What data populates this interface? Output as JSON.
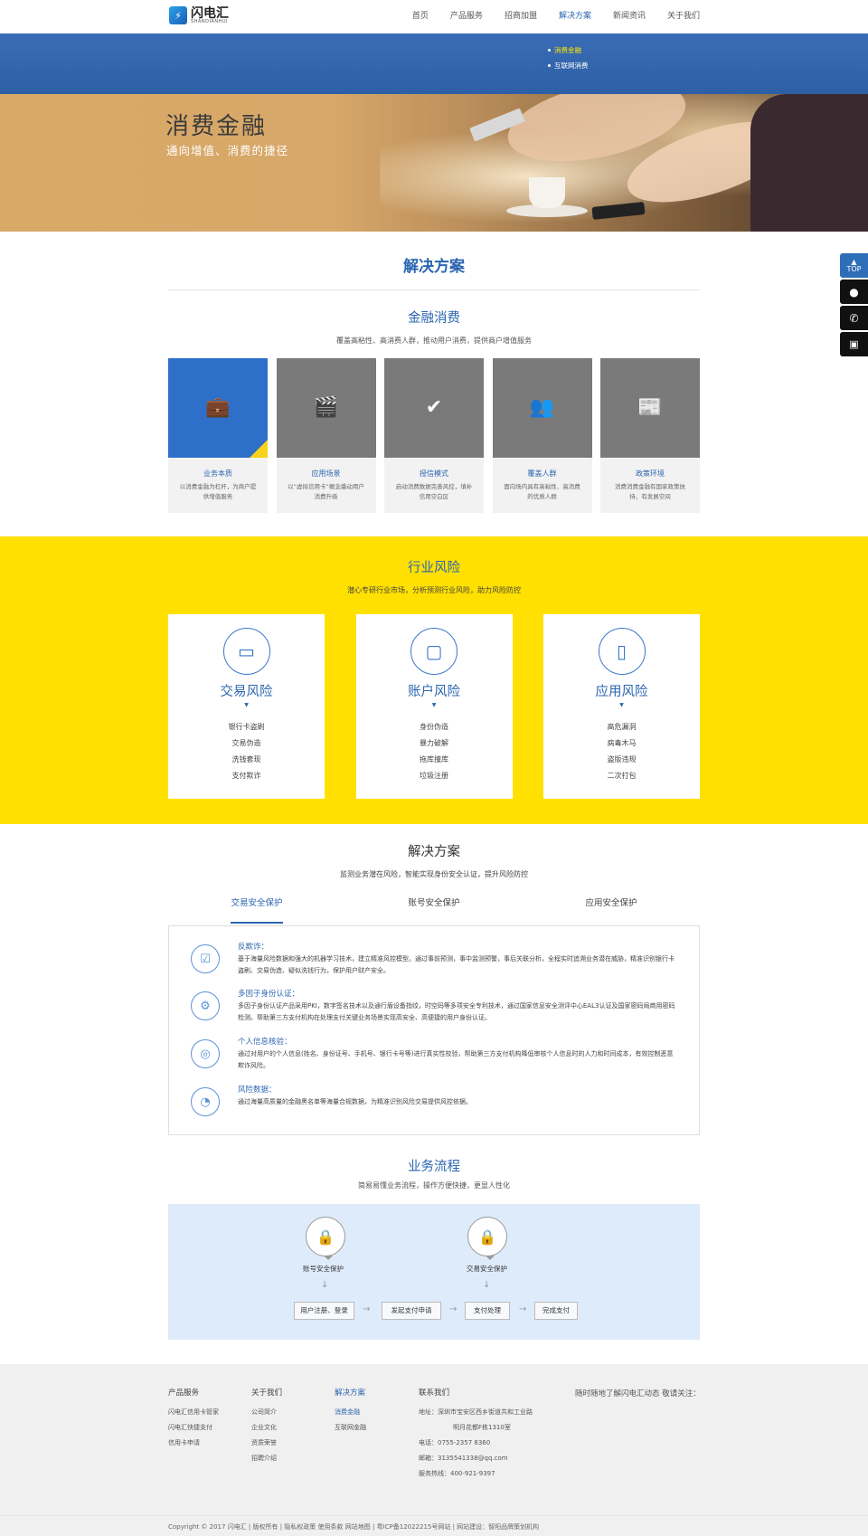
{
  "header": {
    "logo_cn": "闪电汇",
    "logo_en": "SHANDIANHUI",
    "nav": [
      "首页",
      "产品服务",
      "招商加盟",
      "解决方案",
      "新闻资讯",
      "关于我们"
    ]
  },
  "subnav": [
    "消费金融",
    "互联网消费"
  ],
  "banner": {
    "title": "消费金融",
    "subtitle": "通向增值、消费的捷径"
  },
  "side": {
    "top": "TOP"
  },
  "solutions_title": "解决方案",
  "finance": {
    "title": "金融消费",
    "desc": "覆盖高粘性、高消费人群，推动用户消费，提供商户增值服务",
    "cards": [
      {
        "title": "业务本质",
        "desc": "以消费金融为杠杆，为商户提供增值服务"
      },
      {
        "title": "应用场景",
        "desc": "以“虚拟信用卡”概念撬动用户消费升级"
      },
      {
        "title": "授信模式",
        "desc": "启动消费数据完善风控，填补信用空白区"
      },
      {
        "title": "覆盖人群",
        "desc": "面向场内具有高粘性、高消费的优质人群"
      },
      {
        "title": "政策环境",
        "desc": "消费消费金融有国家政策扶持，有发展空间"
      }
    ]
  },
  "risk": {
    "title": "行业风险",
    "desc": "潜心专研行业市场，分析预测行业风险，助力风险防控",
    "cards": [
      {
        "title": "交易风险",
        "items": [
          "银行卡盗刷",
          "交易伪造",
          "洗钱套现",
          "支付欺诈"
        ]
      },
      {
        "title": "账户风险",
        "items": [
          "身份伪造",
          "暴力破解",
          "拖库撞库",
          "垃圾注册"
        ]
      },
      {
        "title": "应用风险",
        "items": [
          "高危漏洞",
          "病毒木马",
          "盗版违规",
          "二次打包"
        ]
      }
    ]
  },
  "solution": {
    "title": "解决方案",
    "desc": "监测业务潜在风险，智能实现身份安全认证，提升风险防控",
    "tabs": [
      "交易安全保护",
      "账号安全保护",
      "应用安全保护"
    ],
    "items": [
      {
        "title": "反欺诈：",
        "body": "基于海量风险数据和强大的机器学习技术，建立精准风控模型。通过事前预测，事中监测预警，事后关联分析，全程实时追溯业务潜在威胁，精准识别银行卡盗刷、交易伪造、疑似洗钱行为，保护用户财产安全。"
      },
      {
        "title": "多因子身份认证：",
        "body": "多因子身份认证产品采用PKI，数字签名技术以及通行盾设备指纹，时空码等多项安全专利技术，通过国家信息安全测评中心EAL3认证及国家密码局商用密码检测。帮助第三方支付机构在处理支付关键业务场景实现高安全、高便捷的用户身份认证。"
      },
      {
        "title": "个人信息核验：",
        "body": "通过对用户的个人信息(姓名、身份证号、手机号、银行卡号等)进行真实性校验，帮助第三方支付机构降低审核个人信息时的人力和时间成本，有效控制恶意欺诈风险。"
      },
      {
        "title": "风险数据：",
        "body": "通过海量高质量的金融黑名单等海量合规数据，为精准识别风险交易提供风控依据。"
      }
    ]
  },
  "flow": {
    "title": "业务流程",
    "desc": "简易易懂业务流程，操作方便快捷，更显人性化",
    "locks": [
      "账号安全保护",
      "交易安全保护"
    ],
    "steps": [
      "用户注册、登录",
      "发起支付申请",
      "支付处理",
      "完成支付"
    ],
    "arrow": "→",
    "down": "↓"
  },
  "footer": {
    "cols": [
      {
        "title": "产品服务",
        "items": [
          "闪电汇信用卡管家",
          "闪电汇快捷支付",
          "信用卡申请"
        ]
      },
      {
        "title": "关于我们",
        "items": [
          "公司简介",
          "企业文化",
          "资质荣誉",
          "招聘介绍"
        ]
      },
      {
        "title": "解决方案",
        "items": [
          "消费金融",
          "互联网金融"
        ]
      },
      {
        "title": "联系我们",
        "items": [
          "地址：深圳市宝安区西乡街道共和工业路",
          "明月花都F栋1310室",
          "电话：0755-2357 8360",
          "邮箱：3135541338@qq.com",
          "服务热线：400-921-9397"
        ]
      }
    ],
    "right": "随时随地了解闪电汇动态 敬请关注：",
    "copyright": "Copyright © 2017 闪电汇   |   版权所有   |   隐私权政策   使用条款   网站地图   |   粤ICP备12022215号网站   |   网站建设：智阳品牌策划机构"
  }
}
